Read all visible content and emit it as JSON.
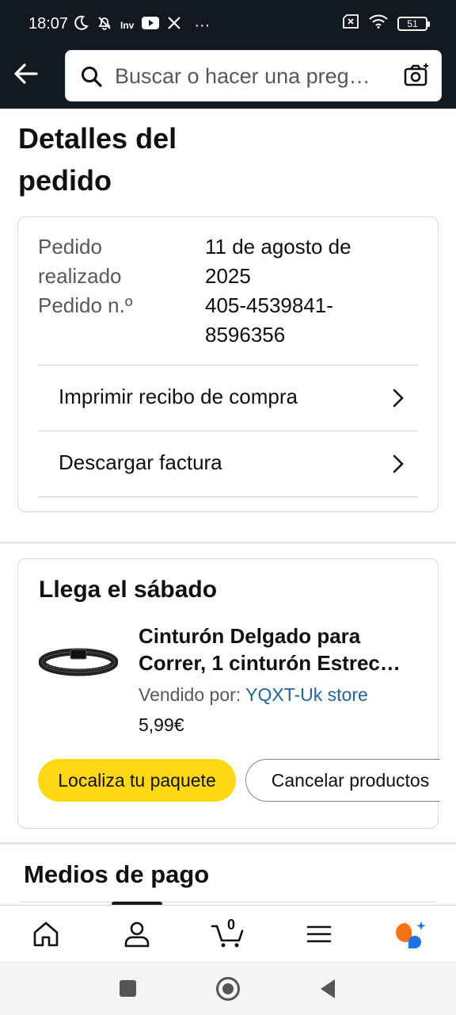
{
  "status_bar": {
    "time": "18:07",
    "left_icons": [
      "moon-icon",
      "bell-off-icon",
      "investing-icon",
      "youtube-icon",
      "x-icon",
      "more-icon"
    ],
    "inv_label": "Inv",
    "more": "···",
    "battery": "51"
  },
  "search": {
    "placeholder": "Buscar o hacer una preg…"
  },
  "page": {
    "title": "Detalles del pedido"
  },
  "order_card": {
    "placed_label": "Pedido realizado",
    "placed_value": "11 de agosto de 2025",
    "number_label": "Pedido n.º",
    "number_value": "405-4539841-8596356",
    "links": [
      {
        "label": "Imprimir recibo de compra"
      },
      {
        "label": "Descargar factura"
      }
    ]
  },
  "shipment": {
    "arrival": "Llega el sábado",
    "product_title_line1": "Cinturón Delgado para",
    "product_title_line2": "Correr, 1 cinturón Estrec…",
    "sold_by_label": "Vendido por:",
    "seller": "YQXT-Uk store",
    "price": "5,99€",
    "track_button": "Localiza tu paquete",
    "cancel_button": "Cancelar productos"
  },
  "payments": {
    "title": "Medios de pago"
  },
  "bottom_nav": {
    "cart_count": "0",
    "items": [
      "home-icon",
      "account-icon",
      "cart-icon",
      "menu-icon",
      "rufus-icon"
    ]
  },
  "colors": {
    "header": "#131921",
    "accent_yellow": "#ffd814",
    "link_blue": "#2162a1",
    "rufus_orange": "#f97316",
    "rufus_blue": "#1a73e8"
  }
}
